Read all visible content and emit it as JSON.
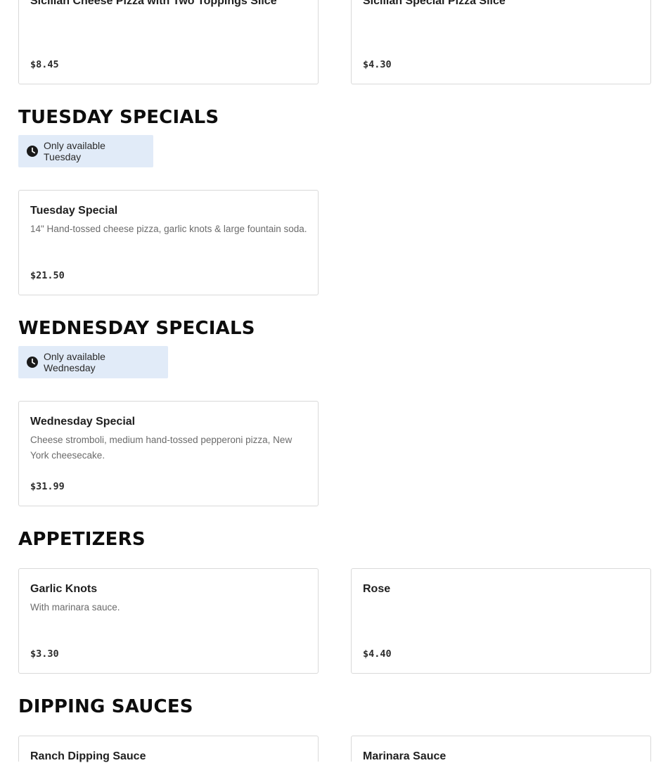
{
  "colors": {
    "availability_badge_bg": "#e1ebf8",
    "card_border": "#d9d9d9",
    "heading": "#0d0d0d"
  },
  "top_items": [
    {
      "name": "Sicilian Cheese Pizza with Two Toppings Slice",
      "price": "$8.45"
    },
    {
      "name": "Sicilian Special Pizza Slice",
      "price": "$4.30"
    }
  ],
  "tuesday": {
    "title": "TUESDAY SPECIALS",
    "availability": "Only available Tuesday",
    "availability_icon": "clock-icon",
    "items": [
      {
        "name": "Tuesday Special",
        "description": "14\" Hand-tossed cheese pizza, garlic knots & large fountain soda.",
        "price": "$21.50"
      }
    ]
  },
  "wednesday": {
    "title": "WEDNESDAY SPECIALS",
    "availability": "Only available Wednesday",
    "availability_icon": "clock-icon",
    "items": [
      {
        "name": "Wednesday Special",
        "description": "Cheese stromboli, medium hand-tossed pepperoni pizza, New York cheesecake.",
        "price": "$31.99"
      }
    ]
  },
  "appetizers": {
    "title": "APPETIZERS",
    "items": [
      {
        "name": "Garlic Knots",
        "description": "With marinara sauce.",
        "price": "$3.30"
      },
      {
        "name": "Rose",
        "price": "$4.40"
      }
    ]
  },
  "dipping_sauces": {
    "title": "DIPPING SAUCES",
    "items": [
      {
        "name": "Ranch Dipping Sauce"
      },
      {
        "name": "Marinara Sauce"
      }
    ]
  }
}
